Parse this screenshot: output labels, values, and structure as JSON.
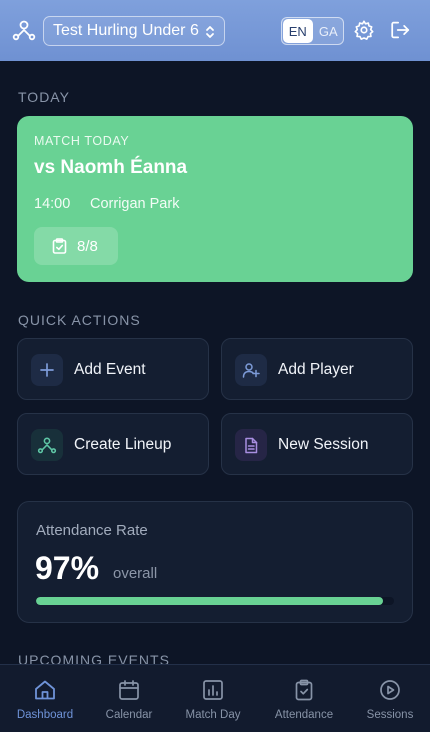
{
  "header": {
    "team_icon": "team-icon",
    "team_name": "Test Hurling Under 6",
    "lang_options": [
      "EN",
      "GA"
    ],
    "lang_selected": "EN",
    "settings_icon": "gear-icon",
    "logout_icon": "logout-icon"
  },
  "today": {
    "section_label": "TODAY",
    "match": {
      "tag": "MATCH TODAY",
      "opponent": "vs Naomh Éanna",
      "time": "14:00",
      "venue": "Corrigan Park",
      "availability": "8/8",
      "availability_icon": "clipboard-check-icon"
    }
  },
  "quick_actions": {
    "section_label": "QUICK ACTIONS",
    "items": [
      {
        "label": "Add Event",
        "icon": "plus-icon",
        "color": "#7d9bd8"
      },
      {
        "label": "Add Player",
        "icon": "user-plus-icon",
        "color": "#7d9bd8"
      },
      {
        "label": "Create Lineup",
        "icon": "lineup-icon",
        "color": "#5fc7a6"
      },
      {
        "label": "New Session",
        "icon": "document-icon",
        "color": "#a88ee0"
      }
    ]
  },
  "attendance": {
    "title": "Attendance Rate",
    "value": "97%",
    "sub": "overall",
    "progress": 0.97
  },
  "upcoming": {
    "section_label": "UPCOMING EVENTS"
  },
  "nav": {
    "items": [
      {
        "label": "Dashboard",
        "icon": "home-icon",
        "active": true
      },
      {
        "label": "Calendar",
        "icon": "calendar-icon",
        "active": false
      },
      {
        "label": "Match Day",
        "icon": "chart-icon",
        "active": false
      },
      {
        "label": "Attendance",
        "icon": "clipboard-check-icon",
        "active": false
      },
      {
        "label": "Sessions",
        "icon": "play-circle-icon",
        "active": false
      }
    ]
  },
  "colors": {
    "background": "#0d1526",
    "header": "#7599d6",
    "accent_green": "#69d294",
    "accent_blue": "#6f93d8"
  }
}
